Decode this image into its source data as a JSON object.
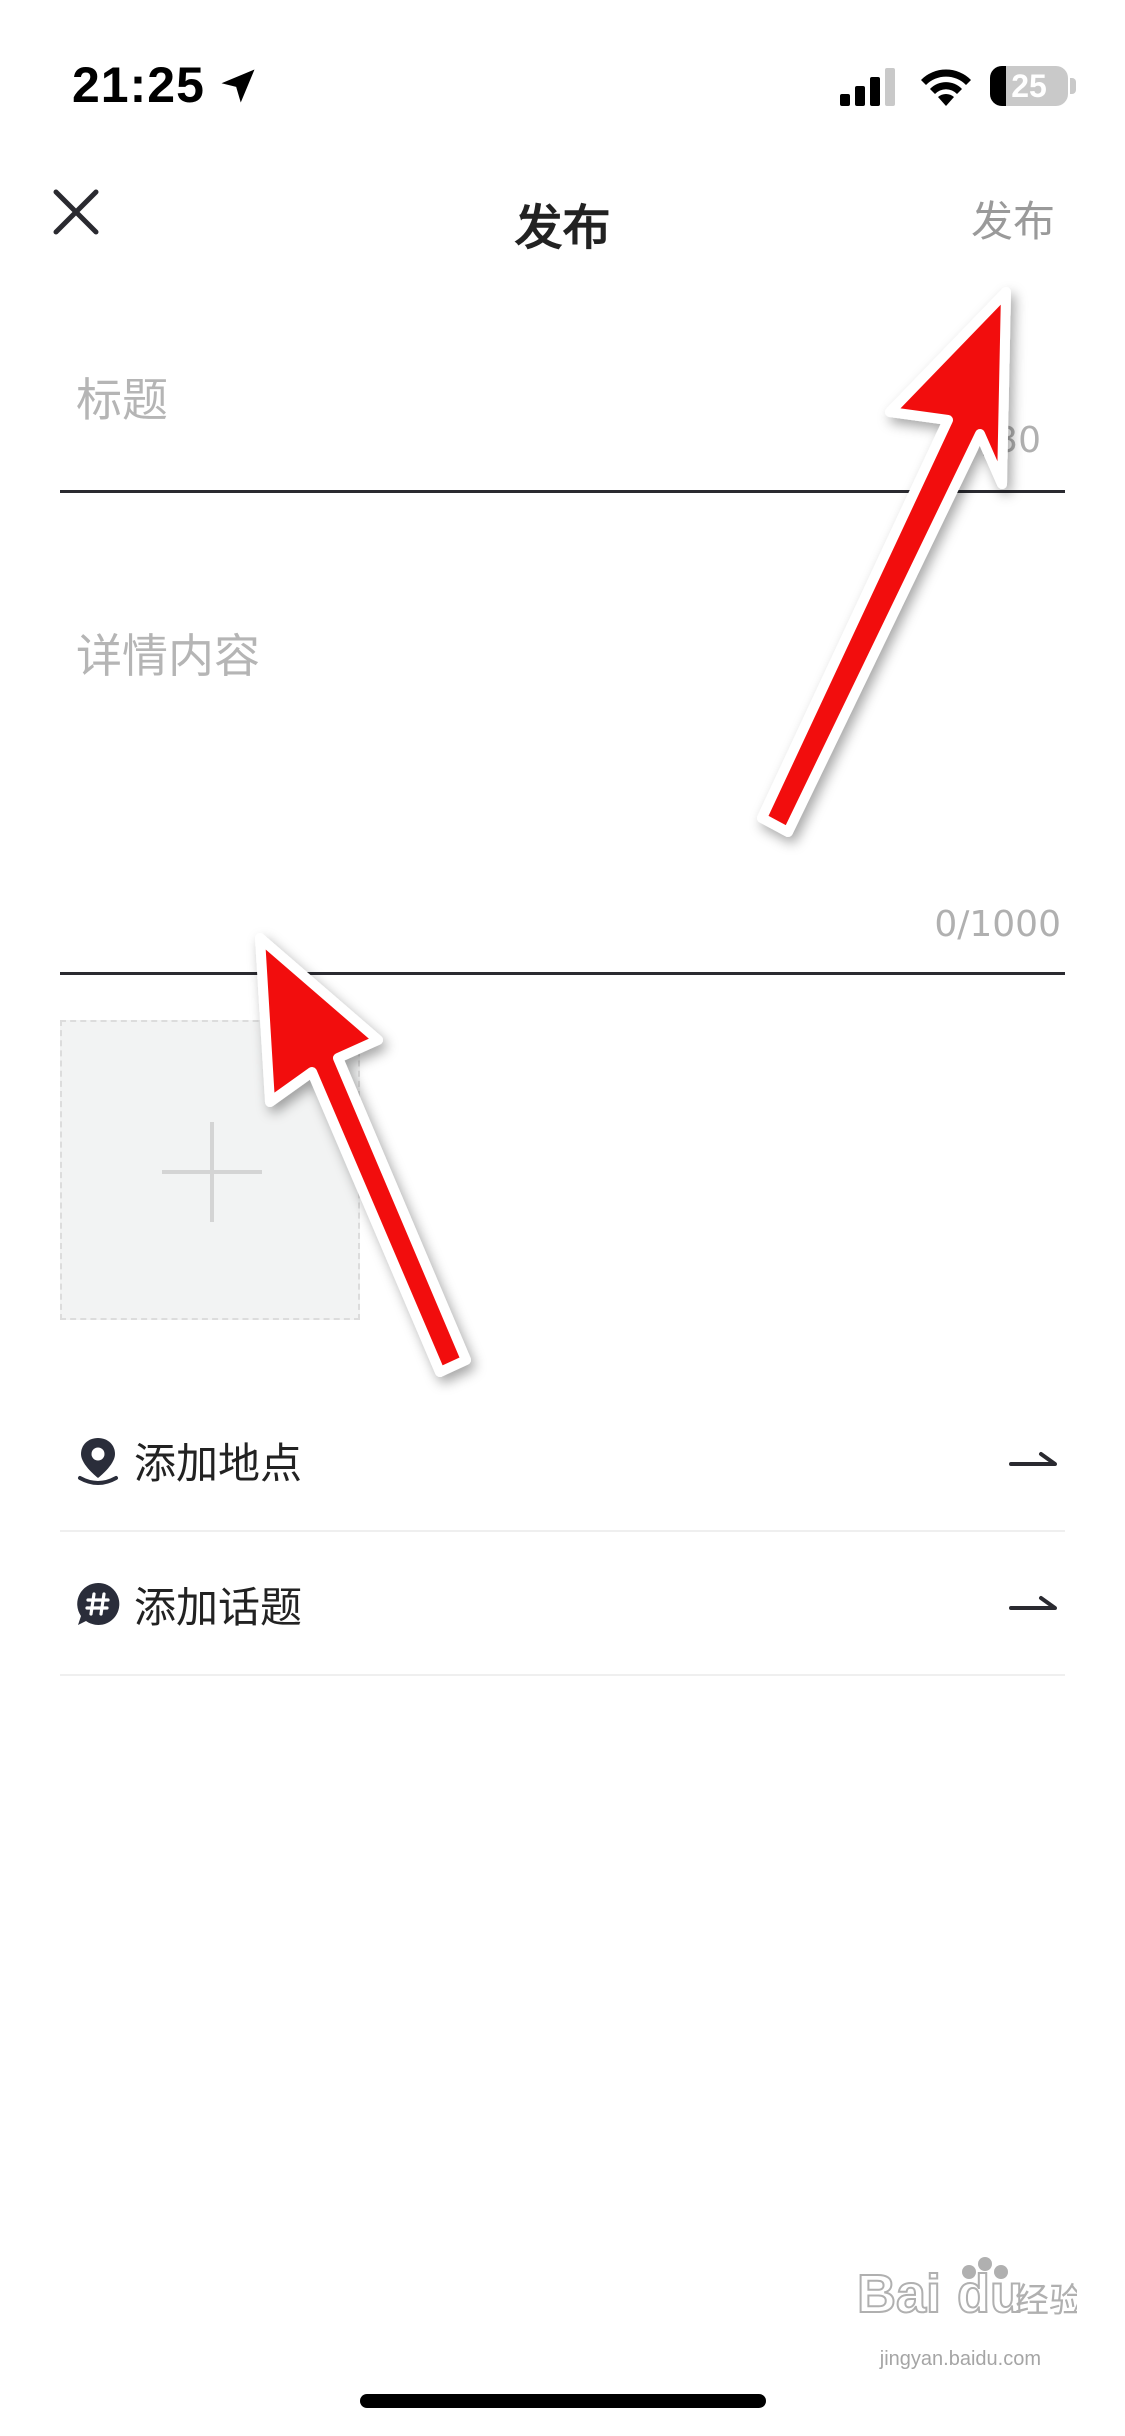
{
  "status_bar": {
    "time": "21:25",
    "battery": "25"
  },
  "header": {
    "title": "发布",
    "publish_label": "发布"
  },
  "form": {
    "title_placeholder": "标题",
    "title_counter": "0/30",
    "content_placeholder": "详情内容",
    "content_counter": "0/1000"
  },
  "rows": [
    {
      "label": "添加地点",
      "icon": "location-pin-icon"
    },
    {
      "label": "添加话题",
      "icon": "hashtag-icon"
    }
  ],
  "colors": {
    "annotation_arrow": "#f21010",
    "divider": "#2a2a30",
    "placeholder": "#b5b5b5"
  },
  "watermark": {
    "brand": "Baidu经验",
    "url": "jingyan.baidu.com"
  }
}
